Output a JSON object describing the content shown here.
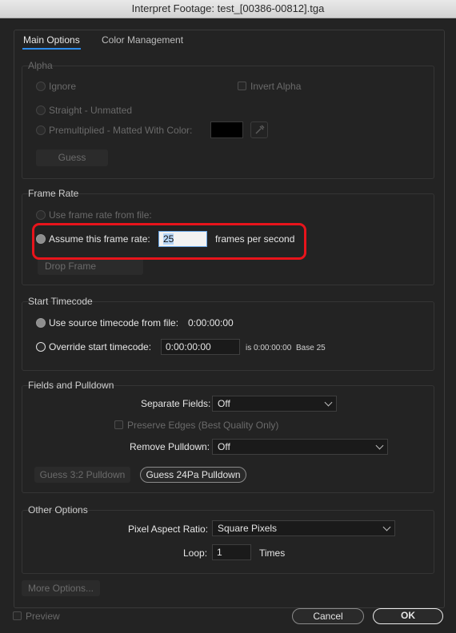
{
  "window": {
    "title": "Interpret Footage: test_[00386-00812].tga"
  },
  "tabs": {
    "main": "Main Options",
    "color": "Color Management"
  },
  "alpha": {
    "title": "Alpha",
    "ignore": "Ignore",
    "invert": "Invert Alpha",
    "straight": "Straight - Unmatted",
    "premult": "Premultiplied - Matted With Color:",
    "guess": "Guess",
    "matte_color": "#000000"
  },
  "frame_rate": {
    "title": "Frame Rate",
    "use_file": "Use frame rate from file:",
    "assume": "Assume this frame rate:",
    "value": "25",
    "unit": "frames per second",
    "drop": "Drop Frame"
  },
  "timecode": {
    "title": "Start Timecode",
    "use_source": "Use source timecode from file:",
    "source_value": "0:00:00:00",
    "override": "Override start timecode:",
    "override_value": "0:00:00:00",
    "is": "is 0:00:00:00",
    "base": "Base 25"
  },
  "fields": {
    "title": "Fields and Pulldown",
    "separate_label": "Separate Fields:",
    "separate_value": "Off",
    "preserve": "Preserve Edges (Best Quality Only)",
    "remove_label": "Remove Pulldown:",
    "remove_value": "Off",
    "guess32": "Guess 3:2 Pulldown",
    "guess24": "Guess 24Pa Pulldown"
  },
  "other": {
    "title": "Other Options",
    "par_label": "Pixel Aspect Ratio:",
    "par_value": "Square Pixels",
    "loop_label": "Loop:",
    "loop_value": "1",
    "times": "Times"
  },
  "footer": {
    "more": "More Options...",
    "preview": "Preview",
    "cancel": "Cancel",
    "ok": "OK"
  },
  "colors": {
    "accent": "#2d8ceb",
    "highlight": "#e8141b"
  }
}
